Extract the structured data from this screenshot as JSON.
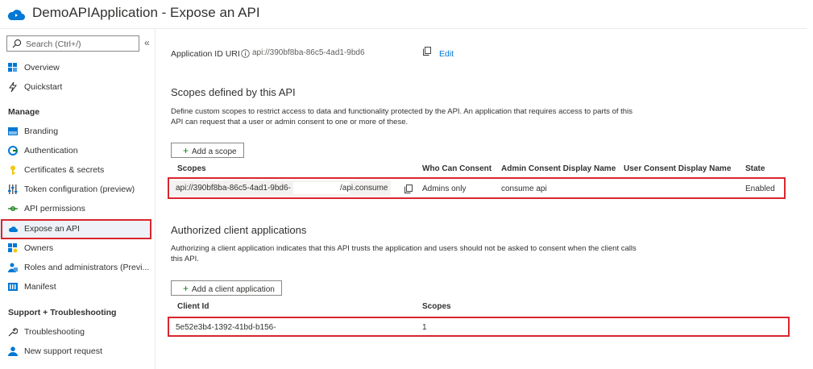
{
  "header": {
    "title": "DemoAPIApplication - Expose an API"
  },
  "sidebar": {
    "search_placeholder": "Search (Ctrl+/)",
    "collapse_glyph": "«",
    "top_items": [
      {
        "label": "Overview",
        "icon": "overview-icon"
      },
      {
        "label": "Quickstart",
        "icon": "quickstart-icon"
      }
    ],
    "manage_heading": "Manage",
    "manage_items": [
      {
        "label": "Branding",
        "icon": "branding-icon"
      },
      {
        "label": "Authentication",
        "icon": "authentication-icon"
      },
      {
        "label": "Certificates & secrets",
        "icon": "key-icon"
      },
      {
        "label": "Token configuration (preview)",
        "icon": "token-icon"
      },
      {
        "label": "API permissions",
        "icon": "api-permissions-icon"
      },
      {
        "label": "Expose an API",
        "icon": "cloud-icon",
        "selected": true
      },
      {
        "label": "Owners",
        "icon": "owners-icon"
      },
      {
        "label": "Roles and administrators (Previ...",
        "icon": "roles-icon"
      },
      {
        "label": "Manifest",
        "icon": "manifest-icon"
      }
    ],
    "support_heading": "Support + Troubleshooting",
    "support_items": [
      {
        "label": "Troubleshooting",
        "icon": "wrench-icon"
      },
      {
        "label": "New support request",
        "icon": "support-icon"
      }
    ]
  },
  "app_id": {
    "label": "Application ID URI",
    "info_glyph": "i",
    "value": "api://390bf8ba-86c5-4ad1-9bd6",
    "edit_label": "Edit"
  },
  "scopes": {
    "heading": "Scopes defined by this API",
    "description_line1": "Define custom scopes to restrict access to data and functionality protected by the API. An application that requires access to parts of this",
    "description_line2": "API can request that a user or admin consent to one or more of these.",
    "add_label": "Add a scope",
    "columns": [
      "Scopes",
      "Who Can Consent",
      "Admin Consent Display Name",
      "User Consent Display Name",
      "State"
    ],
    "row": {
      "scope_prefix": "api://390bf8ba-86c5-4ad1-9bd6-",
      "scope_suffix": "/api.consume",
      "who_can_consent": "Admins only",
      "admin_consent_display_name": "consume api",
      "user_consent_display_name": "",
      "state": "Enabled"
    }
  },
  "clients": {
    "heading": "Authorized client applications",
    "description_line1": "Authorizing a client application indicates that this API trusts the application and users should not be asked to consent when the client calls",
    "description_line2": "this API.",
    "add_label": "Add a client application",
    "columns": [
      "Client Id",
      "Scopes"
    ],
    "row": {
      "client_id": "5e52e3b4-1392-41bd-b156-",
      "scopes": "1"
    }
  },
  "plus_glyph": "+",
  "colors": {
    "accent": "#0078d4",
    "highlight": "#d9262d",
    "plus": "#107c10"
  }
}
